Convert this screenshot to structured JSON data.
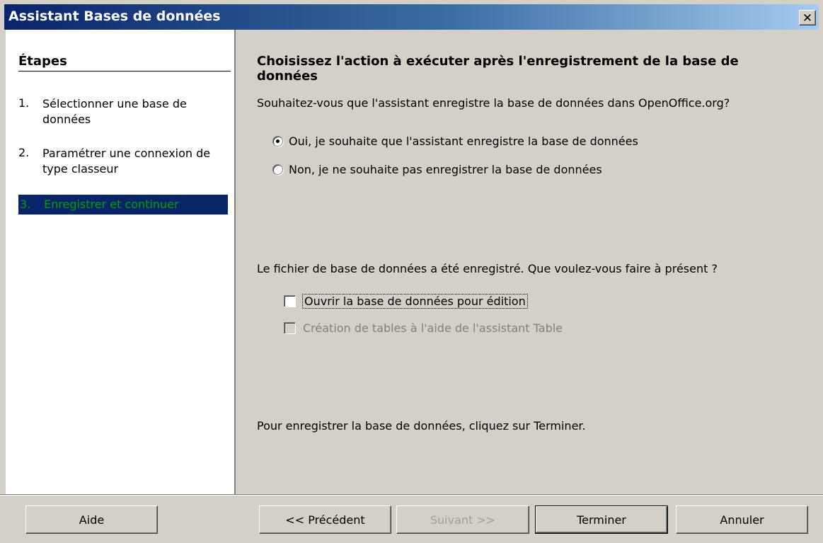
{
  "window": {
    "title": "Assistant Bases de données",
    "close_glyph": "✕"
  },
  "steps": {
    "heading": "Étapes",
    "items": [
      {
        "num": "1.",
        "label": "Sélectionner une base de données",
        "active": false
      },
      {
        "num": "2.",
        "label": "Paramétrer une connexion de type classeur",
        "active": false
      },
      {
        "num": "3.",
        "label": "Enregistrer et continuer",
        "active": true
      }
    ]
  },
  "content": {
    "title": "Choisissez l'action à exécuter après l'enregistrement de la base de données",
    "question": "Souhaitez-vous que l'assistant enregistre la base de données dans OpenOffice.org?",
    "radios": [
      {
        "label": "Oui, je souhaite que l'assistant enregistre la base de données",
        "checked": true
      },
      {
        "label": "Non, je ne souhaite pas enregistrer la base de données",
        "checked": false
      }
    ],
    "saved_message": "Le fichier de base de données a été enregistré. Que voulez-vous faire à présent ?",
    "checkboxes": [
      {
        "label": "Ouvrir la base de données pour édition",
        "checked": false,
        "enabled": true
      },
      {
        "label": "Création de tables à l'aide de l'assistant Table",
        "checked": false,
        "enabled": false
      }
    ],
    "finish_hint": "Pour enregistrer la base de données, cliquez sur Terminer."
  },
  "buttons": {
    "help": "Aide",
    "previous": "<< Précédent",
    "next": "Suivant >>",
    "finish": "Terminer",
    "cancel": "Annuler"
  },
  "colors": {
    "title_bar_start": "#0a246a",
    "title_bar_end": "#a6caf0",
    "active_step_bg": "#0a246a",
    "active_step_text": "#00a000",
    "dialog_bg": "#d4d0c8"
  }
}
